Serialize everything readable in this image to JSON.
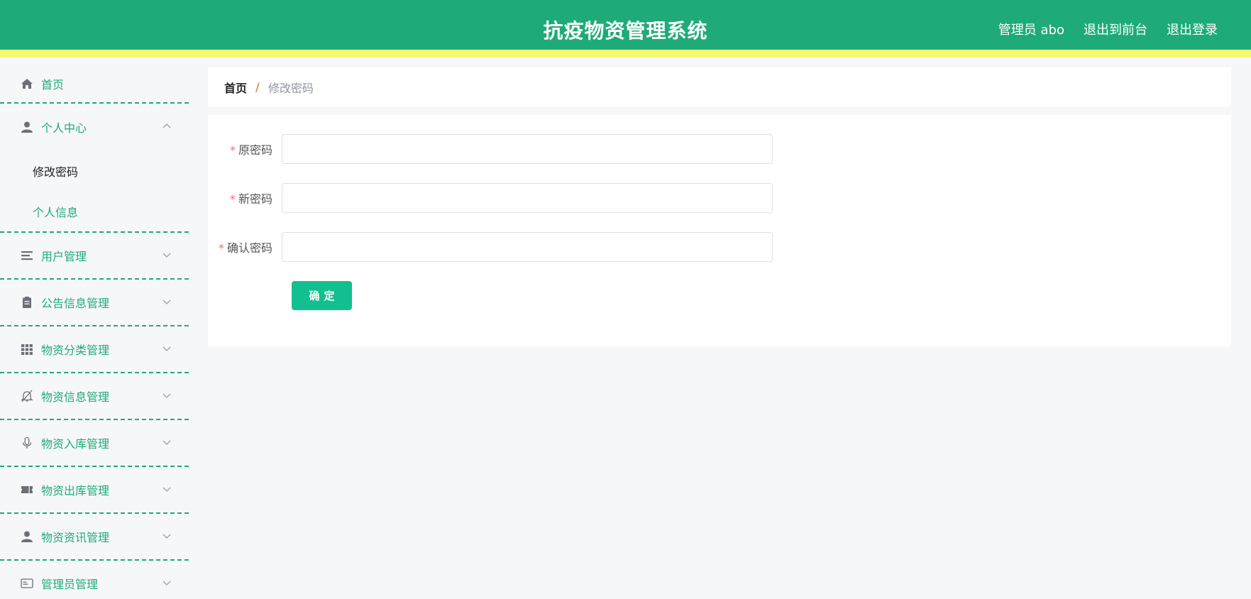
{
  "header": {
    "title": "抗疫物资管理系统",
    "user_label": "管理员 abo",
    "front_link": "退出到前台",
    "logout_link": "退出登录"
  },
  "sidebar": {
    "home": "首页",
    "personal": "个人中心",
    "personal_sub": [
      "修改密码",
      "个人信息"
    ],
    "items": [
      {
        "label": "用户管理",
        "icon": "list-icon"
      },
      {
        "label": "公告信息管理",
        "icon": "clipboard-icon"
      },
      {
        "label": "物资分类管理",
        "icon": "grid-icon"
      },
      {
        "label": "物资信息管理",
        "icon": "bell-off-icon"
      },
      {
        "label": "物资入库管理",
        "icon": "microphone-icon"
      },
      {
        "label": "物资出库管理",
        "icon": "ticket-icon"
      },
      {
        "label": "物资资讯管理",
        "icon": "user-icon"
      },
      {
        "label": "管理员管理",
        "icon": "id-card-icon"
      }
    ]
  },
  "breadcrumb": {
    "home": "首页",
    "separator": "/",
    "current": "修改密码"
  },
  "form": {
    "required_mark": "*",
    "old_password_label": "原密码",
    "new_password_label": "新密码",
    "confirm_password_label": "确认密码",
    "old_password_value": "",
    "new_password_value": "",
    "confirm_password_value": "",
    "submit_label": "确定"
  },
  "colors": {
    "header_bg": "#1fab78",
    "header_stripe": "#f4fb6f",
    "accent": "#1fab78",
    "button": "#11c08e",
    "required": "#f56c6c"
  }
}
